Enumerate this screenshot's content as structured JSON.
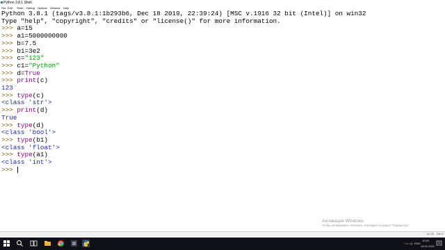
{
  "window": {
    "title": "Python 3.8.1 Shell",
    "menu": [
      "File",
      "Edit",
      "Shell",
      "Debug",
      "Options",
      "Window",
      "Help"
    ]
  },
  "shell": {
    "banner1": "Python 3.8.1 (tags/v3.8.1:1b293b6, Dec 18 2019, 22:39:24) [MSC v.1916 32 bit (Intel)] on win32",
    "banner2": "Type \"help\", \"copyright\", \"credits\" or \"license()\" for more information.",
    "prompt": ">>> ",
    "lines": [
      {
        "prompt": ">>> ",
        "code": "a=15"
      },
      {
        "prompt": ">>> ",
        "code": "a1=5000000000"
      },
      {
        "prompt": ">>> ",
        "code": "b=7.5"
      },
      {
        "prompt": ">>> ",
        "code": "b1=3e2"
      },
      {
        "prompt": ">>> ",
        "pre": "c=",
        "str": "\"123\""
      },
      {
        "prompt": ">>> ",
        "pre": "c1=",
        "str": "\"Python\""
      },
      {
        "prompt": ">>> ",
        "pre": "d=",
        "kw": "True"
      },
      {
        "prompt": ">>> ",
        "fn": "print",
        "args": "(c)"
      },
      {
        "output": "123"
      },
      {
        "prompt": ">>> ",
        "fn": "type",
        "args": "(c)"
      },
      {
        "output": "<class 'str'>"
      },
      {
        "prompt": ">>> ",
        "fn": "print",
        "args": "(d)"
      },
      {
        "output": "True"
      },
      {
        "prompt": ">>> ",
        "fn": "type",
        "args": "(d)"
      },
      {
        "output": "<class 'bool'>"
      },
      {
        "prompt": ">>> ",
        "fn": "type",
        "args": "(b1)"
      },
      {
        "output": "<class 'float'>"
      },
      {
        "prompt": ">>> ",
        "fn": "type",
        "args": "(a1)"
      },
      {
        "output": "<class 'int'>"
      }
    ]
  },
  "status": {
    "line": "Ln: 22",
    "col": "Col: 4"
  },
  "watermark": {
    "line1": "Активация Windows",
    "line2": "Чтобы активировать Windows, перейдите в раздел \"Параметры\"."
  },
  "taskbar": {
    "lang": "ENG",
    "time": "10:50",
    "date": "19.01.2021"
  },
  "colors": {
    "prompt": "#7a5e00",
    "keyword": "#8b00a3",
    "string": "#00a000",
    "builtin": "#900090",
    "output": "#1e2aa8"
  }
}
